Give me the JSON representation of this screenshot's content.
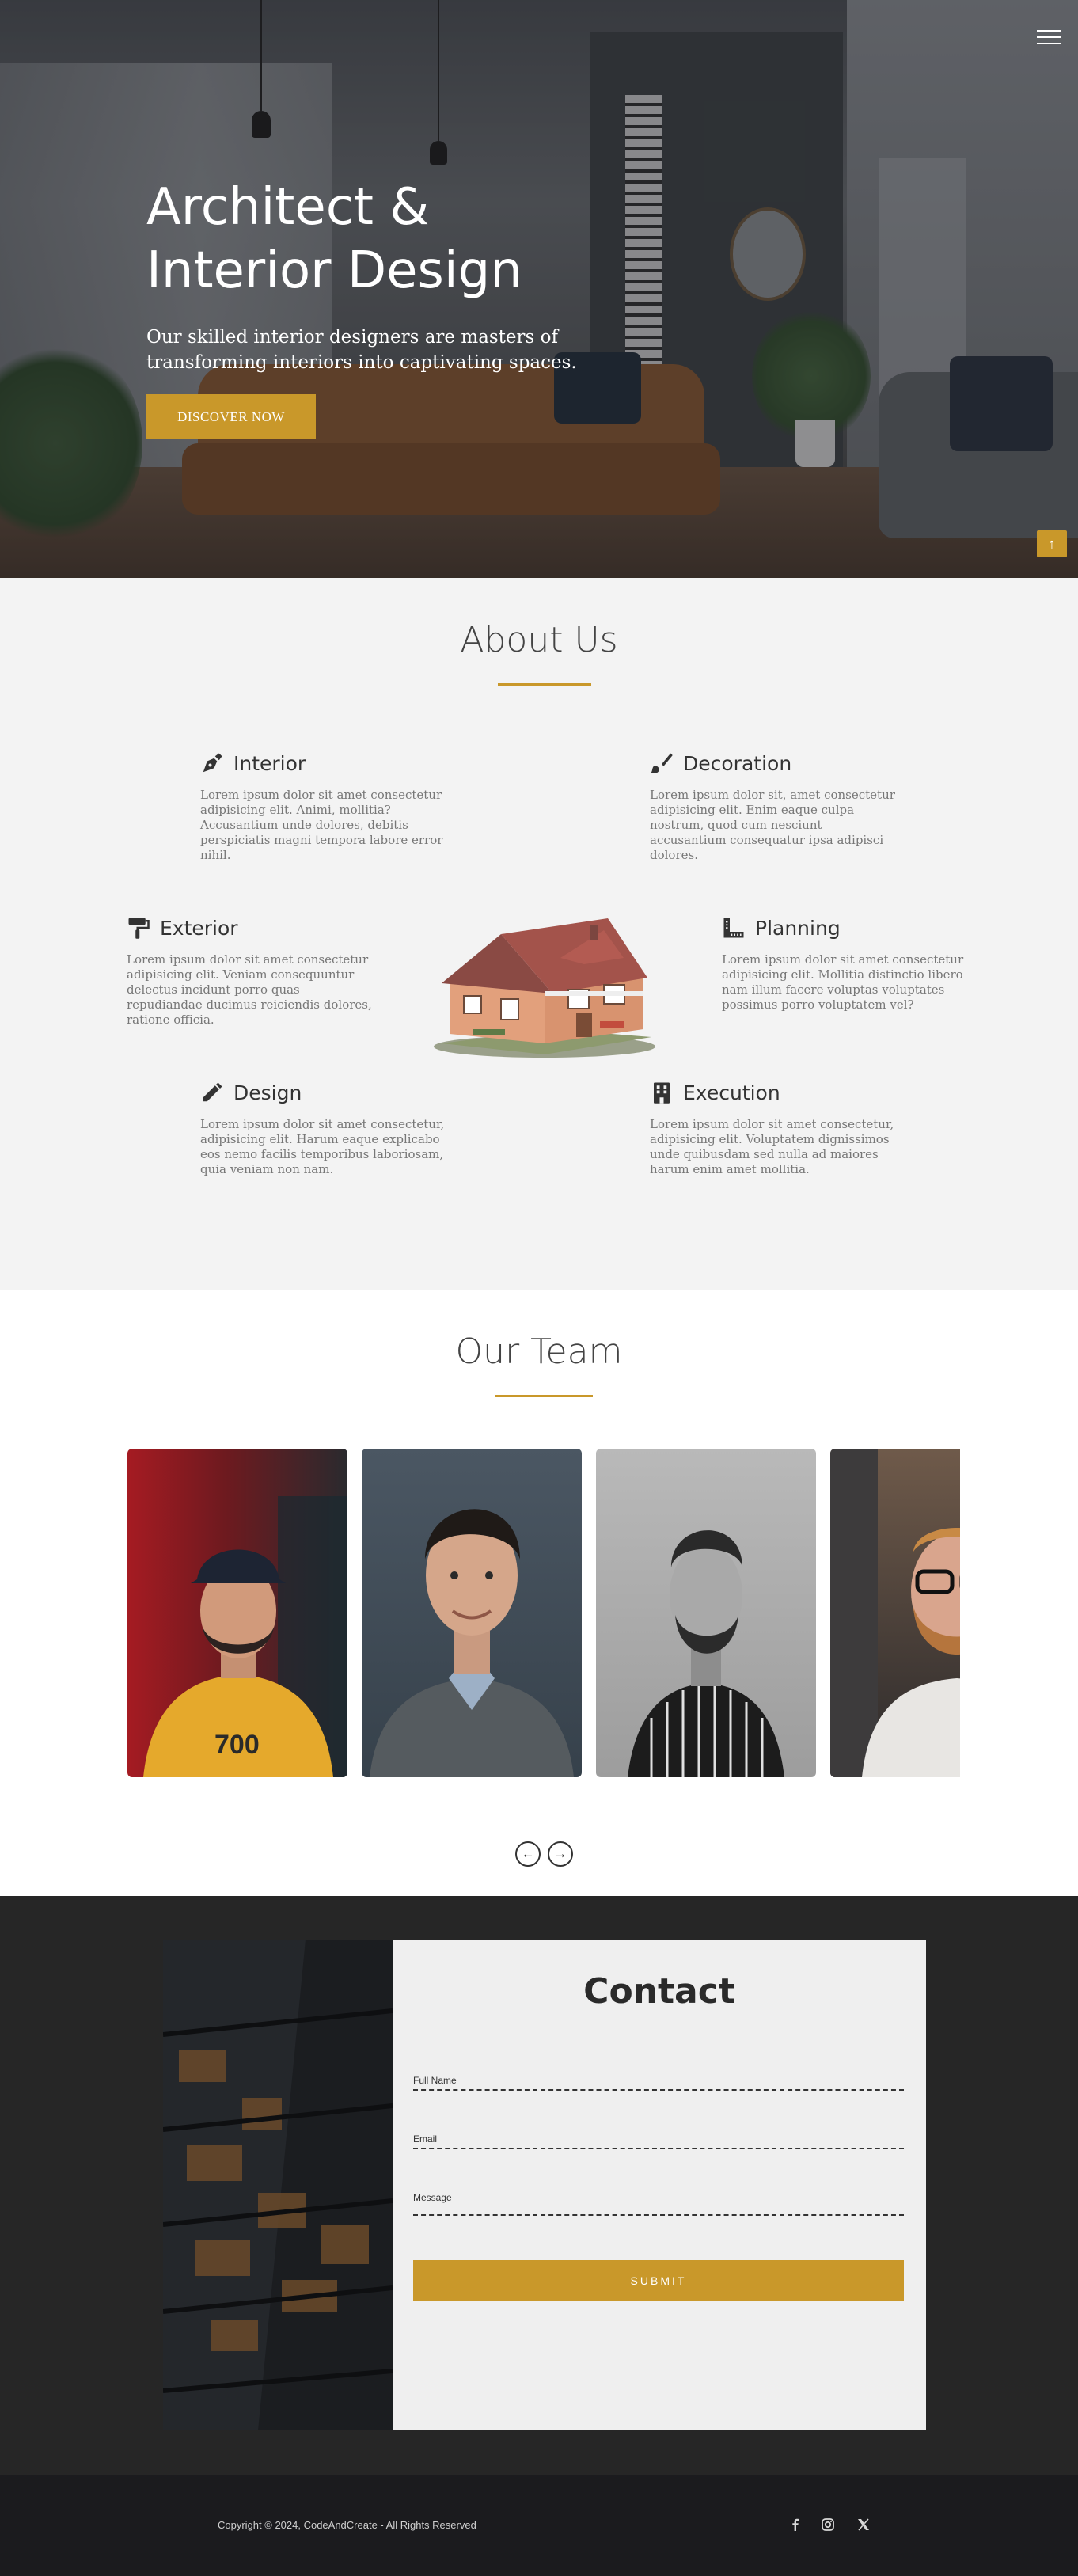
{
  "hero": {
    "title_line1": "Architect &",
    "title_line2": "Interior Design",
    "subtitle": "Our skilled interior designers are masters of transforming interiors into captivating spaces.",
    "cta_label": "DISCOVER NOW",
    "scroll_top_icon": "arrow-up-icon",
    "menu_icon": "hamburger-icon"
  },
  "about": {
    "title": "About Us",
    "features": [
      {
        "title": "Interior",
        "icon": "pen-nib-icon",
        "text": "Lorem ipsum dolor sit amet consectetur adipisicing elit. Animi, mollitia? Accusantium unde dolores, debitis perspiciatis magni tempora labore error nihil."
      },
      {
        "title": "Decoration",
        "icon": "paint-brush-icon",
        "text": "Lorem ipsum dolor sit, amet consectetur adipisicing elit. Enim eaque culpa nostrum, quod cum nesciunt accusantium consequatur ipsa adipisci dolores."
      },
      {
        "title": "Exterior",
        "icon": "paint-roller-icon",
        "text": "Lorem ipsum dolor sit amet consectetur adipisicing elit. Veniam consequuntur delectus incidunt porro quas repudiandae ducimus reiciendis dolores, ratione officia."
      },
      {
        "title": "Planning",
        "icon": "ruler-icon",
        "text": "Lorem ipsum dolor sit amet consectetur adipisicing elit. Mollitia distinctio libero nam illum facere voluptas voluptates possimus porro voluptatem vel?"
      },
      {
        "title": "Design",
        "icon": "pencil-icon",
        "text": "Lorem ipsum dolor sit amet consectetur, adipisicing elit. Harum eaque explicabo eos nemo facilis temporibus laboriosam, quia veniam non nam."
      },
      {
        "title": "Execution",
        "icon": "building-icon",
        "text": "Lorem ipsum dolor sit amet consectetur, adipisicing elit. Voluptatem dignissimos unde quibusdam sed nulla ad maiores harum enim amet mollitia."
      }
    ]
  },
  "team": {
    "title": "Our Team",
    "prev_icon": "arrow-left-icon",
    "next_icon": "arrow-right-icon"
  },
  "contact": {
    "title": "Contact",
    "full_name_label": "Full Name",
    "email_label": "Email",
    "message_label": "Message",
    "submit_label": "SUBMIT"
  },
  "footer": {
    "copyright": "Copyright © 2024, CodeAndCreate - All Rights Reserved",
    "social_icons": [
      "facebook-icon",
      "instagram-icon",
      "x-twitter-icon"
    ]
  },
  "colors": {
    "accent": "#c9982a",
    "dark_bg": "#262626",
    "footer_bg": "#1b1b1e",
    "about_bg": "#f3f3f3"
  }
}
